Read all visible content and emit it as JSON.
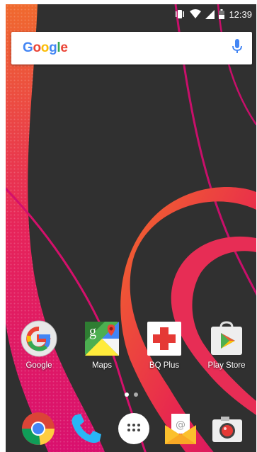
{
  "status_bar": {
    "time": "12:39"
  },
  "search": {
    "logo_text": "Google",
    "logo_letters": [
      "G",
      "o",
      "o",
      "g",
      "l",
      "e"
    ],
    "logo_colors": [
      "#4285F4",
      "#EA4335",
      "#FBBC05",
      "#4285F4",
      "#34A853",
      "#EA4335"
    ]
  },
  "home_apps": [
    {
      "label": "Google"
    },
    {
      "label": "Maps"
    },
    {
      "label": "BQ Plus"
    },
    {
      "label": "Play Store"
    }
  ],
  "page_indicator": {
    "pages": 2,
    "current": 1
  },
  "dock": [
    {
      "icon": "chrome-icon"
    },
    {
      "icon": "phone-icon"
    },
    {
      "icon": "app-drawer-icon"
    },
    {
      "icon": "email-icon"
    },
    {
      "icon": "camera-icon"
    }
  ],
  "colors": {
    "wallpaper_bg": "#2f2f2f",
    "accent_pink": "#e0126b",
    "accent_orange": "#f26a2a"
  }
}
